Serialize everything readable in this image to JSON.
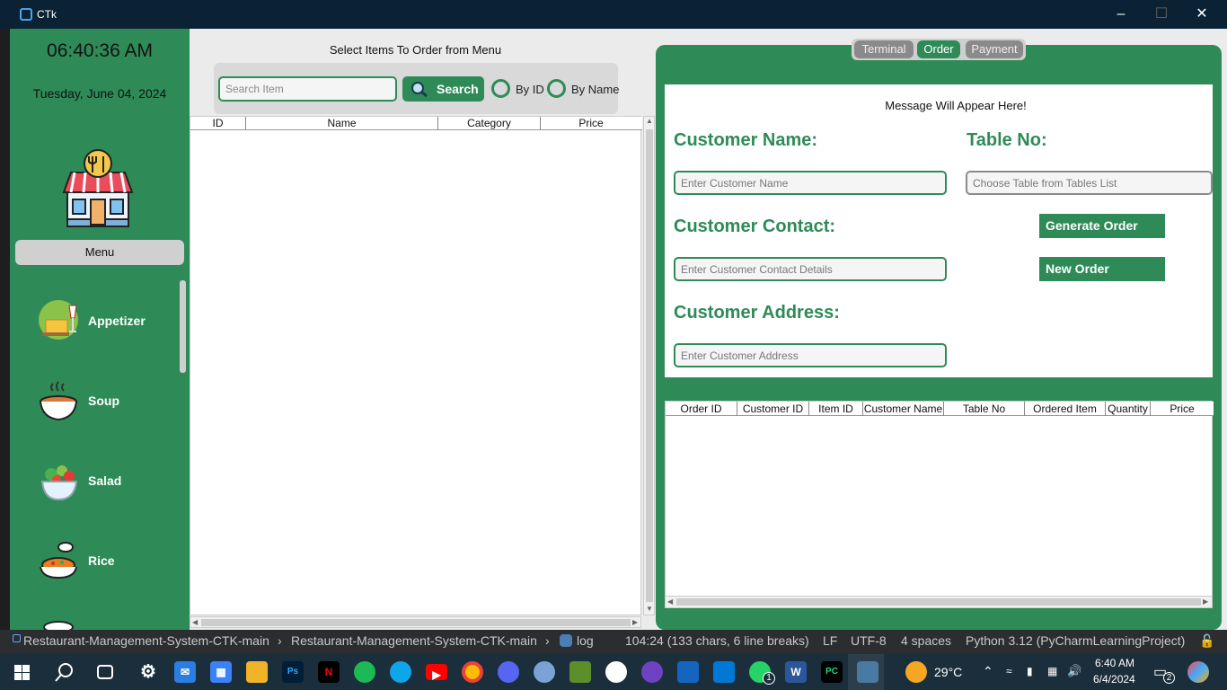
{
  "window": {
    "title": "CTk"
  },
  "sidebar": {
    "time": "06:40:36 AM",
    "date": "Tuesday, June 04, 2024",
    "menu_label": "Menu",
    "categories": [
      {
        "label": "Appetizer",
        "icon": "appetizer-icon"
      },
      {
        "label": "Soup",
        "icon": "soup-icon"
      },
      {
        "label": "Salad",
        "icon": "salad-icon"
      },
      {
        "label": "Rice",
        "icon": "rice-icon"
      }
    ]
  },
  "items_panel": {
    "title": "Select Items To Order from Menu",
    "search_placeholder": "Search Item",
    "search_button": "Search",
    "radio_by_id": "By ID",
    "radio_by_name": "By Name",
    "columns": [
      "ID",
      "Name",
      "Category",
      "Price"
    ]
  },
  "tabs": [
    "Terminal",
    "Order",
    "Payment"
  ],
  "active_tab": "Order",
  "order_form": {
    "message": "Message Will Appear Here!",
    "customer_name_label": "Customer Name:",
    "customer_name_placeholder": "Enter Customer Name",
    "table_no_label": "Table No:",
    "table_no_placeholder": "Choose Table from Tables List",
    "customer_contact_label": "Customer Contact:",
    "customer_contact_placeholder": "Enter Customer Contact Details",
    "customer_address_label": "Customer Address:",
    "customer_address_placeholder": "Enter Customer Address",
    "generate_order_button": "Generate Order",
    "new_order_button": "New Order"
  },
  "orders_table": {
    "columns": [
      "Order ID",
      "Customer ID",
      "Item ID",
      "Customer Name",
      "Table No",
      "Ordered Item",
      "Quantity",
      "Price"
    ]
  },
  "ide_status": {
    "breadcrumb_1": "Restaurant-Management-System-CTK-main",
    "breadcrumb_2": "Restaurant-Management-System-CTK-main",
    "breadcrumb_3": "log",
    "position": "104:24 (133 chars, 6 line breaks)",
    "line_ending": "LF",
    "encoding": "UTF-8",
    "indent": "4 spaces",
    "interpreter": "Python 3.12 (PyCharmLearningProject)"
  },
  "taskbar": {
    "weather": "29°C",
    "clock_time": "6:40 AM",
    "clock_date": "6/4/2024",
    "whatsapp_badge": "1",
    "notification_badge": "2"
  },
  "colors": {
    "accent_green": "#2e8b57",
    "tab_inactive": "#8a8a8a"
  }
}
